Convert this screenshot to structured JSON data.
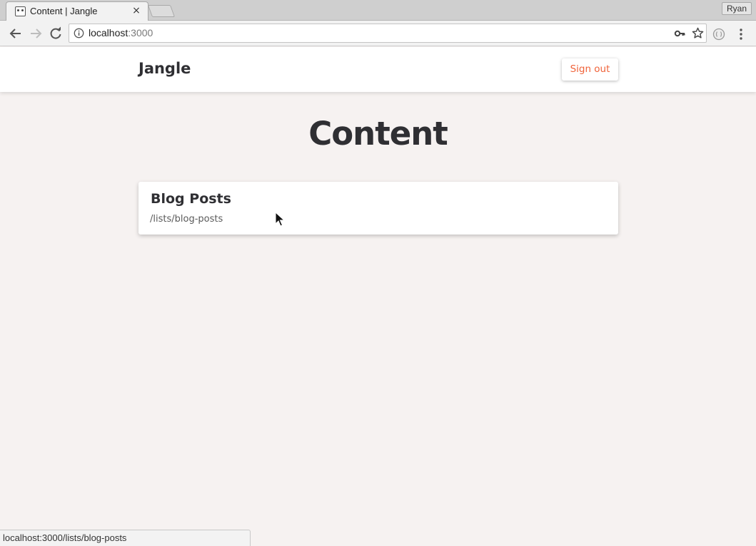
{
  "browser": {
    "tab_title": "Content | Jangle",
    "tab_close": "×",
    "profile_name": "Ryan",
    "url_host": "localhost",
    "url_port": ":3000",
    "status_url": "localhost:3000/lists/blog-posts"
  },
  "header": {
    "brand": "Jangle",
    "signout_label": "Sign out"
  },
  "main": {
    "title": "Content",
    "lists": [
      {
        "title": "Blog Posts",
        "path": "/lists/blog-posts"
      }
    ]
  },
  "colors": {
    "accent": "#f0633a",
    "page_bg": "#f6f2f1",
    "text": "#2f2f33"
  }
}
